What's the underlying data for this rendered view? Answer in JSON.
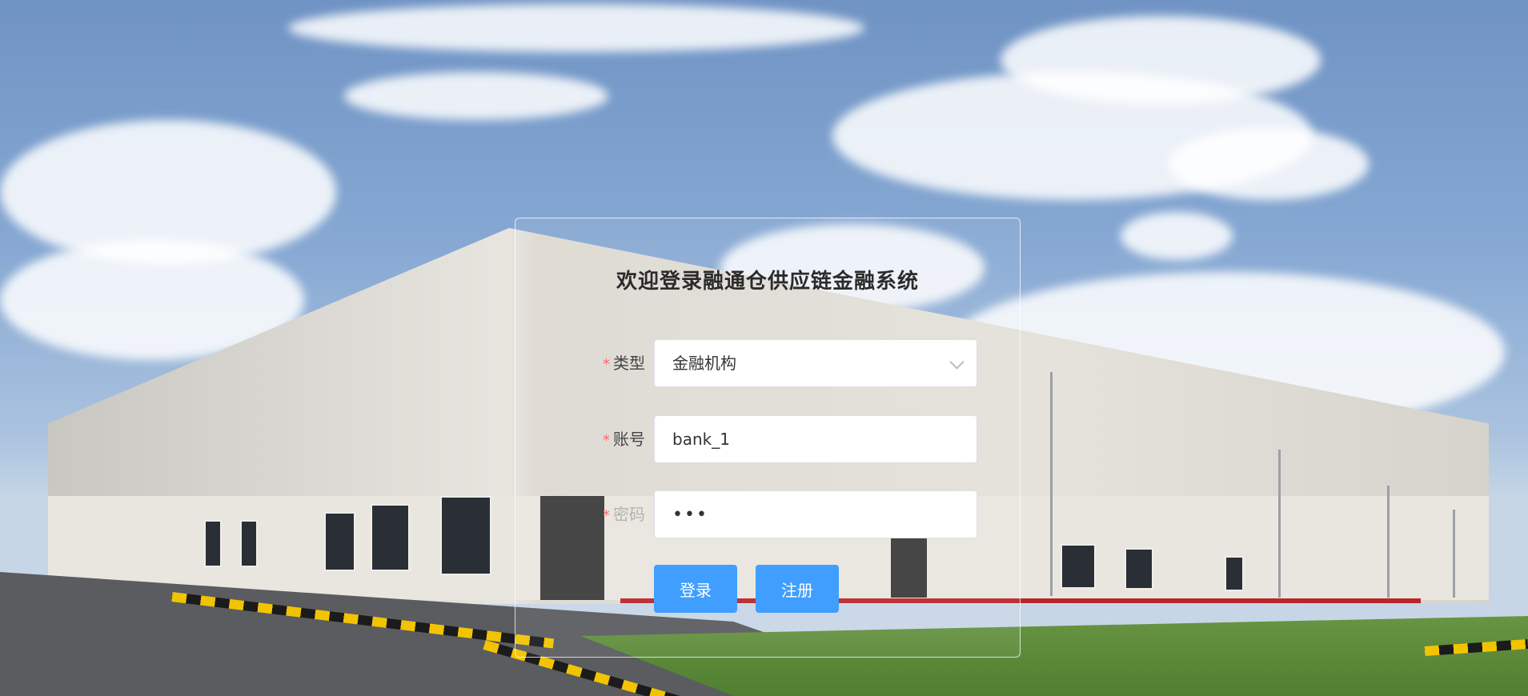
{
  "login": {
    "title": "欢迎登录融通仓供应链金融系统",
    "type_label": "类型",
    "type_value": "金融机构",
    "account_label": "账号",
    "account_value": "bank_1",
    "password_label": "密码",
    "password_value": "•••",
    "login_button": "登录",
    "register_button": "注册",
    "required_mark": "*"
  },
  "colors": {
    "primary": "#409eff",
    "required": "#f56c6c"
  },
  "icons": {
    "select_caret": "chevron-down-icon"
  }
}
